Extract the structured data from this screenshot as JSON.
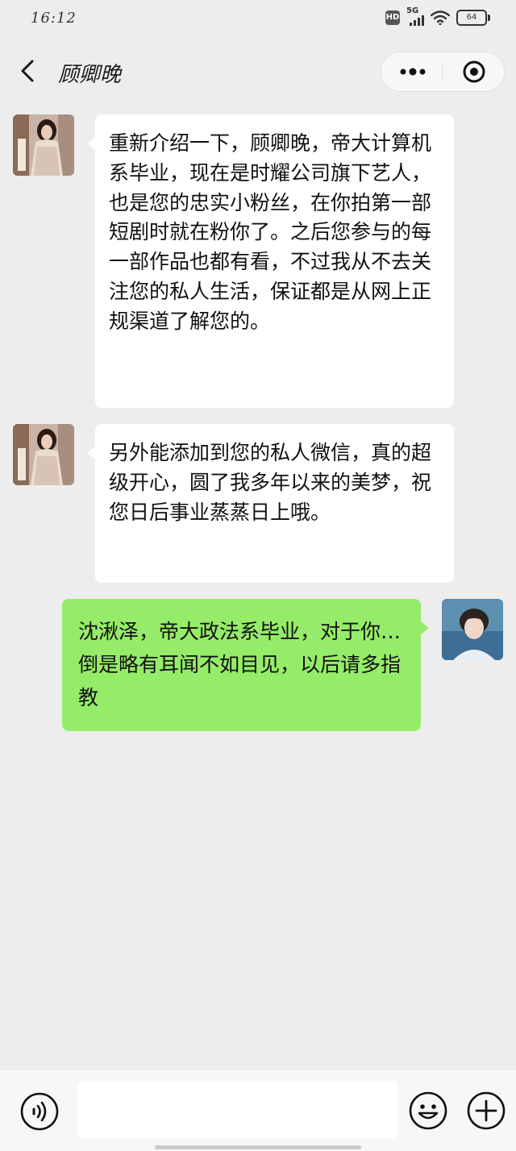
{
  "status": {
    "time": "16:12",
    "hd": "HD",
    "network": "5G",
    "battery": "64"
  },
  "header": {
    "title": "顾卿晚"
  },
  "messages": [
    {
      "side": "left",
      "sender": "contact",
      "text": "重新介绍一下，顾卿晚，帝大计算机系毕业，现在是时耀公司旗下艺人，也是您的忠实小粉丝，在你拍第一部短剧时就在粉你了。之后您参与的每一部作品也都有看，不过我从不去关注您的私人生活，保证都是从网上正规渠道了解您的。"
    },
    {
      "side": "left",
      "sender": "contact",
      "text": "另外能添加到您的私人微信，真的超级开心，圆了我多年以来的美梦，祝您日后事业蒸蒸日上哦。"
    },
    {
      "side": "right",
      "sender": "self",
      "text": "沈湫泽，帝大政法系毕业，对于你…倒是略有耳闻不如目见，以后请多指教"
    }
  ],
  "colors": {
    "background": "#ededed",
    "incoming_bubble": "#ffffff",
    "outgoing_bubble": "#95ec69",
    "bottom_bar": "#f7f7f7"
  }
}
